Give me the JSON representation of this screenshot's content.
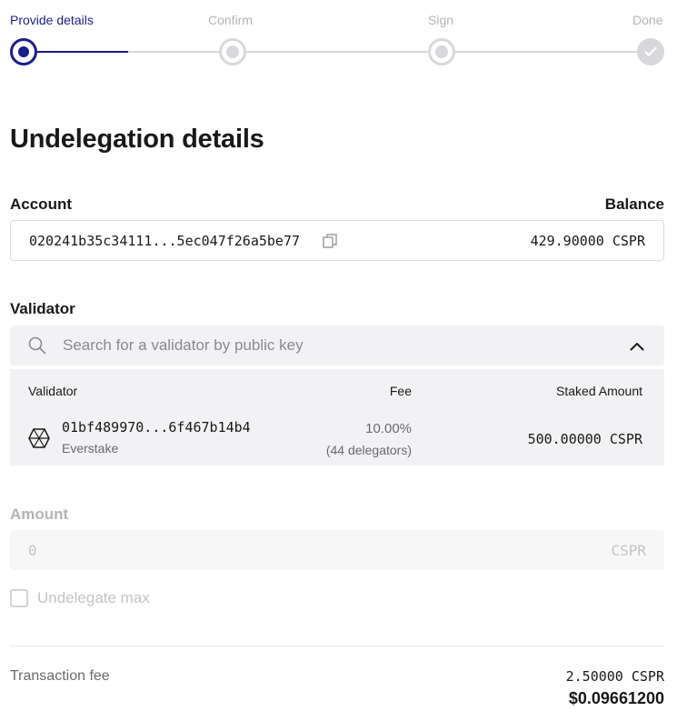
{
  "stepper": {
    "steps": [
      {
        "label": "Provide details",
        "state": "active"
      },
      {
        "label": "Confirm",
        "state": "pending"
      },
      {
        "label": "Sign",
        "state": "pending"
      },
      {
        "label": "Done",
        "state": "done"
      }
    ]
  },
  "page_title": "Undelegation details",
  "account": {
    "label": "Account",
    "balance_label": "Balance",
    "public_key": "020241b35c34111...5ec047f26a5be77",
    "balance": "429.90000 CSPR"
  },
  "validator": {
    "label": "Validator",
    "search_placeholder": "Search for a validator by public key",
    "table": {
      "headers": {
        "validator": "Validator",
        "fee": "Fee",
        "staked": "Staked Amount"
      },
      "rows": [
        {
          "public_key": "01bf489970...6f467b14b4",
          "name": "Everstake",
          "fee": "10.00%",
          "delegators": "(44 delegators)",
          "staked": "500.00000 CSPR"
        }
      ]
    }
  },
  "amount": {
    "label": "Amount",
    "value": "0",
    "unit": "CSPR"
  },
  "undelegate_max": {
    "label": "Undelegate max",
    "checked": false
  },
  "transaction_fee": {
    "label": "Transaction fee",
    "cspr": "2.50000 CSPR",
    "usd": "$0.09661200"
  },
  "colors": {
    "accent": "#1b1e8c",
    "inactive": "#d8d8dc",
    "panel_bg": "#f2f2f4"
  },
  "icons": [
    "copy-icon",
    "search-icon",
    "chevron-up-icon",
    "validator-logo-icon",
    "checkmark-icon"
  ]
}
